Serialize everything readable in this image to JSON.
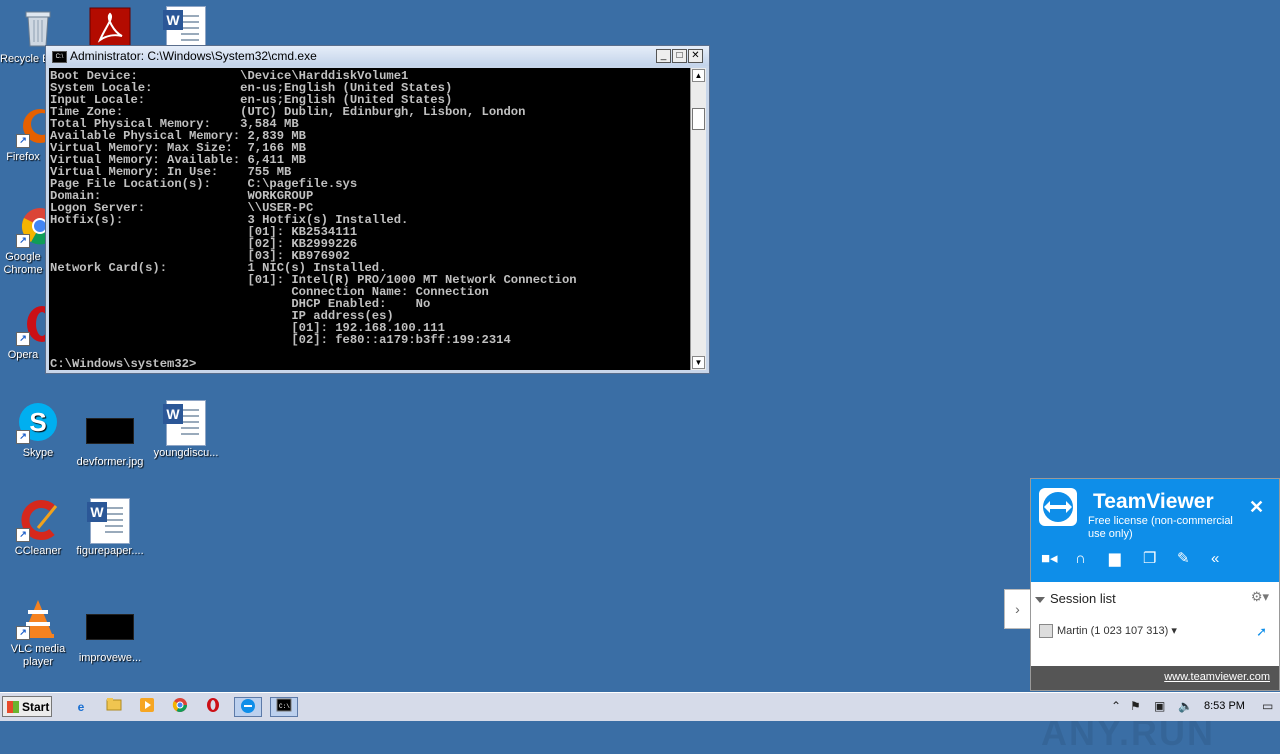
{
  "desktop": {
    "icons": [
      {
        "label": "Recycle Bin",
        "kind": "recycle"
      },
      {
        "label": "Firefox",
        "kind": "firefox"
      },
      {
        "label": "Google Chrome",
        "kind": "chrome"
      },
      {
        "label": "Opera",
        "kind": "opera"
      },
      {
        "label": "Skype",
        "kind": "skype"
      },
      {
        "label": "CCleaner",
        "kind": "ccleaner"
      },
      {
        "label": "VLC media player",
        "kind": "vlc"
      },
      {
        "label": "devformer.jpg",
        "kind": "image"
      },
      {
        "label": "figurepaper....",
        "kind": "word"
      },
      {
        "label": "improvewe...",
        "kind": "image"
      },
      {
        "label": "youngdiscu...",
        "kind": "word"
      }
    ]
  },
  "cmd": {
    "title": "Administrator: C:\\Windows\\System32\\cmd.exe",
    "output": "Boot Device:              \\Device\\HarddiskVolume1\nSystem Locale:            en-us;English (United States)\nInput Locale:             en-us;English (United States)\nTime Zone:                (UTC) Dublin, Edinburgh, Lisbon, London\nTotal Physical Memory:    3,584 MB\nAvailable Physical Memory: 2,839 MB\nVirtual Memory: Max Size:  7,166 MB\nVirtual Memory: Available: 6,411 MB\nVirtual Memory: In Use:    755 MB\nPage File Location(s):     C:\\pagefile.sys\nDomain:                    WORKGROUP\nLogon Server:              \\\\USER-PC\nHotfix(s):                 3 Hotfix(s) Installed.\n                           [01]: KB2534111\n                           [02]: KB2999226\n                           [03]: KB976902\nNetwork Card(s):           1 NIC(s) Installed.\n                           [01]: Intel(R) PRO/1000 MT Network Connection\n                                 Connection Name: Connection\n                                 DHCP Enabled:    No\n                                 IP address(es)\n                                 [01]: 192.168.100.111\n                                 [02]: fe80::a179:b3ff:199:2314\n\nC:\\Windows\\system32>",
    "buttons": {
      "minimize": "_",
      "maximize": "□",
      "close": "✕"
    }
  },
  "teamviewer": {
    "brand": "TeamViewer",
    "license": "Free license (non-commercial use only)",
    "close": "✕",
    "session_header": "Session list",
    "session_row": "Martin (1 023 107 313)",
    "footer_link": "www.teamviewer.com",
    "watermark": "ANY.RUN",
    "handle": "›"
  },
  "taskbar": {
    "start": "Start",
    "clock": "8:53 PM",
    "tray_expand": "⌃"
  }
}
